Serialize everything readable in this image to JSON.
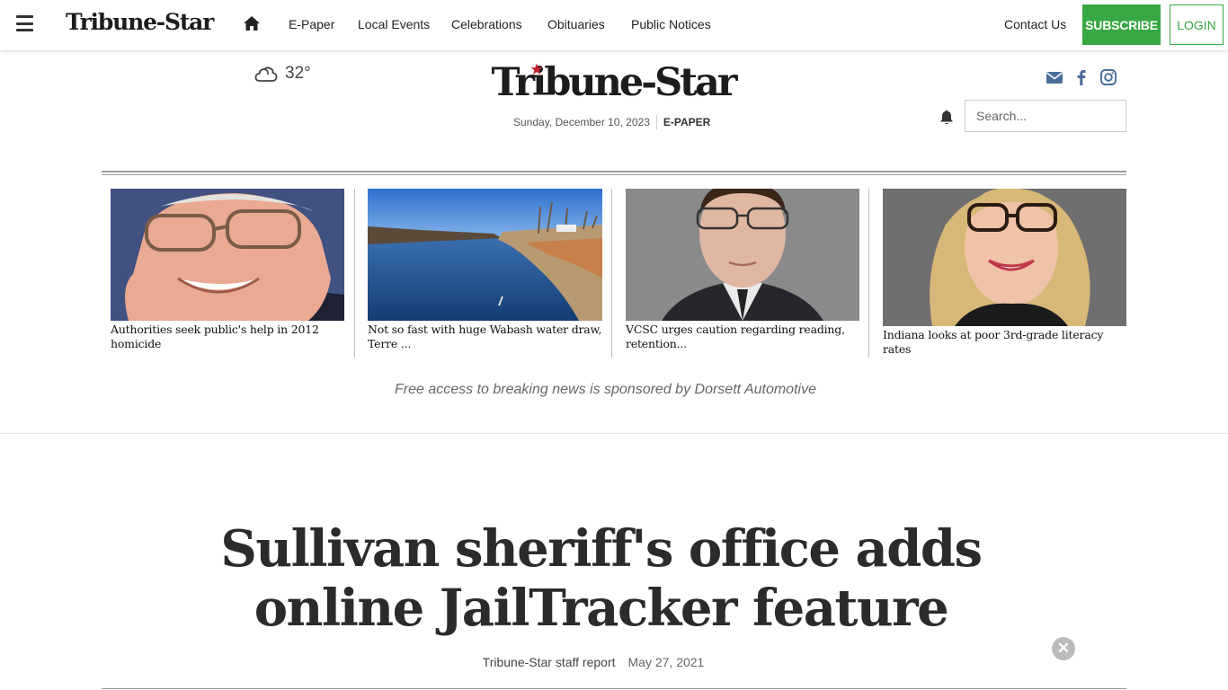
{
  "nav": {
    "logo": "Tribune-Star",
    "links": [
      "E-Paper",
      "Local Events",
      "Celebrations",
      "Obituaries",
      "Public Notices"
    ],
    "contact": "Contact Us",
    "subscribe": "SUBSCRIBE",
    "login": "LOGIN"
  },
  "masthead": {
    "logo": "Tribune-Star",
    "temperature": "32°",
    "weather_icon": "cloud-icon",
    "date": "Sunday, December 10, 2023",
    "epaper": "E-PAPER",
    "search_placeholder": "Search...",
    "social_icons": [
      "envelope-icon",
      "facebook-icon",
      "instagram-icon"
    ]
  },
  "teasers": [
    {
      "caption": "Authorities seek public's help in 2012 homicide",
      "image": "photo of elderly man with glasses"
    },
    {
      "caption": "Not so fast with huge Wabash water draw, Terre ...",
      "image": "photo of river under blue sky"
    },
    {
      "caption": "VCSC urges caution regarding reading, retention...",
      "image": "photo of man in suit with glasses"
    },
    {
      "caption": "Indiana looks at poor 3rd-grade literacy rates",
      "image": "photo of smiling blonde woman with glasses"
    }
  ],
  "sponsor": "Free access to breaking news is sponsored by Dorsett Automotive",
  "article": {
    "headline": "Sullivan sheriff's office adds online JailTracker feature",
    "author": "Tribune-Star staff report",
    "date": "May 27, 2021"
  },
  "colors": {
    "accent": "#38a844",
    "text": "#222222",
    "link_icons": "#4a6d9a"
  }
}
